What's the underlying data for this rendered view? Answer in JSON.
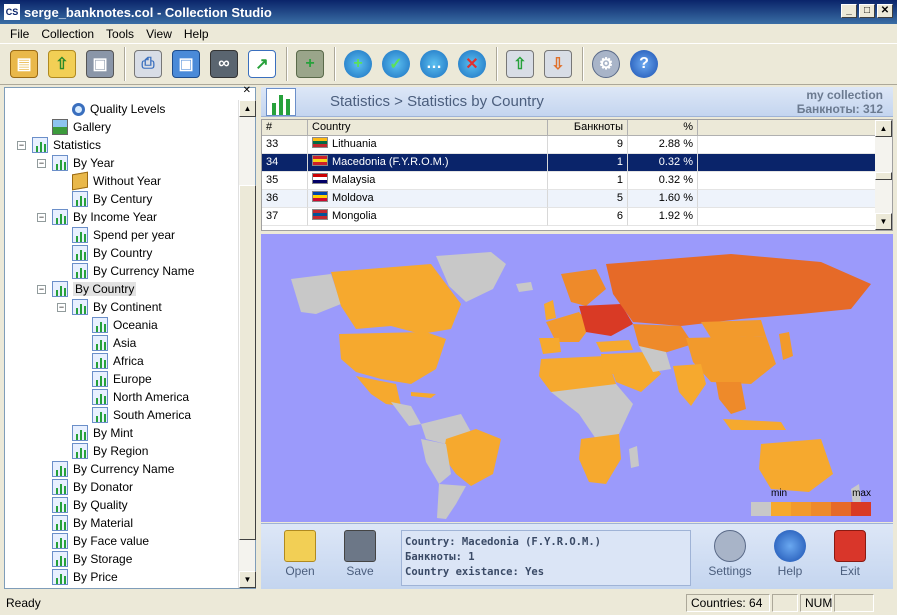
{
  "window": {
    "title": "serge_banknotes.col - Collection Studio",
    "app_icon_text": "CS",
    "min": "_",
    "max": "□",
    "close": "✕"
  },
  "menu": [
    {
      "label": "File"
    },
    {
      "label": "Collection"
    },
    {
      "label": "Tools"
    },
    {
      "label": "View"
    },
    {
      "label": "Help"
    }
  ],
  "toolbar": {
    "icons": [
      "open-collection-icon",
      "open-folder-icon",
      "save-icon",
      "print-icon",
      "save-as-icon",
      "binoculars-search-icon",
      "statistics-icon",
      "add-item-icon",
      "globe-add-icon",
      "globe-check-icon",
      "globe-comment-icon",
      "globe-delete-icon",
      "upload-icon",
      "download-icon",
      "settings-icon",
      "help-icon"
    ]
  },
  "tree": {
    "close_label": "✕",
    "items": [
      {
        "label": "Quality Levels",
        "icon": "magnifier-icon",
        "level": 2
      },
      {
        "label": "Gallery",
        "icon": "gallery-icon",
        "level": 1
      },
      {
        "label": "Statistics",
        "icon": "statistics-icon",
        "level": 0,
        "exp": "−"
      },
      {
        "label": "By Year",
        "icon": "statistics-icon",
        "level": 1,
        "exp": "−"
      },
      {
        "label": "Without Year",
        "icon": "book-icon",
        "level": 2
      },
      {
        "label": "By Century",
        "icon": "statistics-icon",
        "level": 2
      },
      {
        "label": "By Income Year",
        "icon": "statistics-icon",
        "level": 1,
        "exp": "−"
      },
      {
        "label": "Spend per year",
        "icon": "statistics-icon",
        "level": 2
      },
      {
        "label": "By Country",
        "icon": "statistics-icon",
        "level": 2
      },
      {
        "label": "By Currency Name",
        "icon": "statistics-icon",
        "level": 2
      },
      {
        "label": "By Country",
        "icon": "statistics-icon",
        "level": 1,
        "exp": "−",
        "selected": true
      },
      {
        "label": "By Continent",
        "icon": "statistics-icon",
        "level": 2,
        "exp": "−"
      },
      {
        "label": "Oceania",
        "icon": "statistics-icon",
        "level": 3
      },
      {
        "label": "Asia",
        "icon": "statistics-icon",
        "level": 3
      },
      {
        "label": "Africa",
        "icon": "statistics-icon",
        "level": 3
      },
      {
        "label": "Europe",
        "icon": "statistics-icon",
        "level": 3
      },
      {
        "label": "North America",
        "icon": "statistics-icon",
        "level": 3
      },
      {
        "label": "South America",
        "icon": "statistics-icon",
        "level": 3
      },
      {
        "label": "By Mint",
        "icon": "statistics-icon",
        "level": 2
      },
      {
        "label": "By Region",
        "icon": "statistics-icon",
        "level": 2
      },
      {
        "label": "By Currency Name",
        "icon": "statistics-icon",
        "level": 1
      },
      {
        "label": "By Donator",
        "icon": "statistics-icon",
        "level": 1
      },
      {
        "label": "By Quality",
        "icon": "statistics-icon",
        "level": 1
      },
      {
        "label": "By Material",
        "icon": "statistics-icon",
        "level": 1
      },
      {
        "label": "By Face value",
        "icon": "statistics-icon",
        "level": 1
      },
      {
        "label": "By Storage",
        "icon": "statistics-icon",
        "level": 1
      },
      {
        "label": "By Price",
        "icon": "statistics-icon",
        "level": 1
      }
    ]
  },
  "header": {
    "breadcrumb": "Statistics  > Statistics by Country",
    "collection_name": "my collection",
    "collection_count": "Банкноты: 312"
  },
  "table": {
    "columns": [
      "#",
      "Country",
      "Банкноты",
      "%"
    ],
    "rows": [
      {
        "num": "33",
        "country": "Lithuania",
        "count": "9",
        "pct": "2.88 %",
        "flag": [
          "#fdb913",
          "#006a44",
          "#c1272d"
        ]
      },
      {
        "num": "34",
        "country": "Macedonia (F.Y.R.O.M.)",
        "count": "1",
        "pct": "0.32 %",
        "flag": [
          "#ce2028",
          "#f9d616",
          "#ce2028"
        ],
        "selected": true
      },
      {
        "num": "35",
        "country": "Malaysia",
        "count": "1",
        "pct": "0.32 %",
        "flag": [
          "#cc0001",
          "#ffffff",
          "#010066"
        ]
      },
      {
        "num": "36",
        "country": "Moldova",
        "count": "5",
        "pct": "1.60 %",
        "flag": [
          "#0046ae",
          "#ffd200",
          "#cc092f"
        ]
      },
      {
        "num": "37",
        "country": "Mongolia",
        "count": "6",
        "pct": "1.92 %",
        "flag": [
          "#c4272f",
          "#015197",
          "#c4272f"
        ]
      }
    ]
  },
  "legend": {
    "min_label": "min",
    "max_label": "max",
    "colors": [
      "#c8c8c8",
      "#f6a92e",
      "#f29a2c",
      "#ee8a2a",
      "#e66a28",
      "#d93a25"
    ]
  },
  "actions": {
    "open": "Open",
    "save": "Save",
    "settings": "Settings",
    "help": "Help",
    "exit": "Exit"
  },
  "info": {
    "country": "Country: Macedonia (F.Y.R.O.M.)",
    "count": "Банкноты: 1",
    "existence": "Country existance: Yes"
  },
  "status": {
    "text": "Ready",
    "countries": "Countries: 64",
    "num": "NUM"
  },
  "colors": {
    "map_ocean": "#9b9afb",
    "land_none": "#c8c8c8",
    "land_low": "#f6a92e",
    "land_mid": "#ee8a2a",
    "land_high": "#e66a28",
    "land_max": "#d93a25",
    "selection": "#0a246a"
  }
}
